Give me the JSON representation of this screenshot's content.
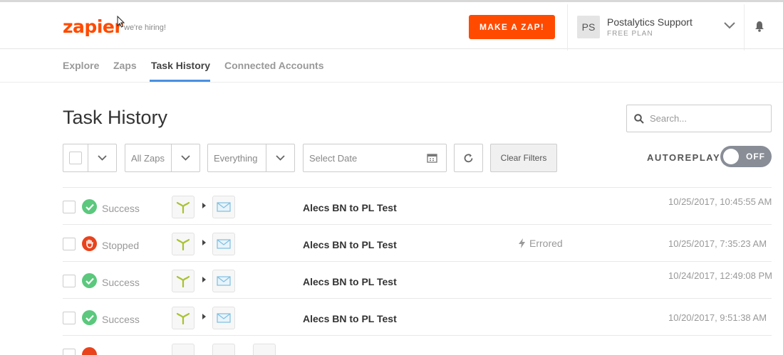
{
  "header": {
    "logo": "zapier",
    "hiring": "we're hiring!",
    "make_zap": "MAKE A ZAP!",
    "avatar_initials": "PS",
    "account_name": "Postalytics Support",
    "account_plan": "FREE PLAN",
    "brand_color": "#ff4a00"
  },
  "nav": {
    "tabs": [
      {
        "label": "Explore"
      },
      {
        "label": "Zaps"
      },
      {
        "label": "Task History",
        "active": true
      },
      {
        "label": "Connected Accounts"
      }
    ],
    "active_color": "#4a90e2"
  },
  "main": {
    "title": "Task History",
    "search_placeholder": "Search...",
    "filters": {
      "zaps": "All Zaps",
      "status": "Everything",
      "date_placeholder": "Select Date",
      "clear": "Clear Filters"
    },
    "autoreplay_label": "AUTOREPLAY",
    "autoreplay_state": "OFF"
  },
  "tasks": [
    {
      "status": "Success",
      "zap": "Alecs BN to PL Test",
      "note": "",
      "time": "10/25/2017, 10:45:55 AM"
    },
    {
      "status": "Stopped",
      "zap": "Alecs BN to PL Test",
      "note": "Errored",
      "time": "10/25/2017, 7:35:23 AM"
    },
    {
      "status": "Success",
      "zap": "Alecs BN to PL Test",
      "note": "",
      "time": "10/24/2017, 12:49:08 PM"
    },
    {
      "status": "Success",
      "zap": "Alecs BN to PL Test",
      "note": "",
      "time": "10/20/2017, 9:51:38 AM"
    }
  ],
  "status_colors": {
    "success": "#5bc87d",
    "stopped": "#e8431c"
  }
}
